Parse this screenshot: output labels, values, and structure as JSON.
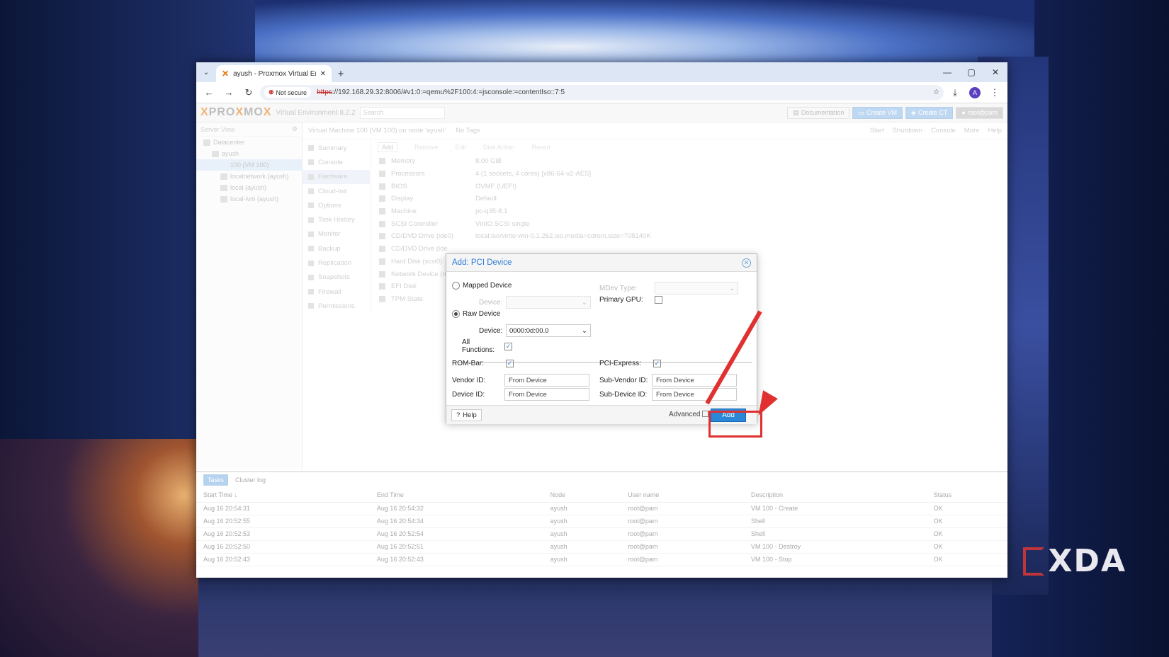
{
  "browser": {
    "tab_title": "ayush - Proxmox Virtual Enviro",
    "not_secure": "Not secure",
    "url_scheme": "https",
    "url_rest": "://192.168.29.32:8006/#v1:0:=qemu%2F100:4:=jsconsole:=contentIso::7:5",
    "avatar_letter": "A"
  },
  "pve": {
    "logo_a": "PRO",
    "logo_x": "X",
    "logo_b": "MO",
    "logo_x2": "X",
    "version": "Virtual Environment 8.2.2",
    "search_placeholder": "Search",
    "header_buttons": [
      "Documentation",
      "Create VM",
      "Create CT",
      "root@pam"
    ],
    "server_view": "Server View",
    "tree": [
      "Datacenter",
      "ayush",
      "100 (VM 100)",
      "localnetwork (ayush)",
      "local (ayush)",
      "local-lvm (ayush)"
    ],
    "crumb_title": "Virtual Machine 100 (VM 100) on node 'ayush'",
    "no_tags": "No Tags",
    "crumb_actions": [
      "Start",
      "Shutdown",
      "Console",
      "More",
      "Help"
    ],
    "vm_nav": [
      "Summary",
      "Console",
      "Hardware",
      "Cloud-Init",
      "Options",
      "Task History",
      "Monitor",
      "Backup",
      "Replication",
      "Snapshots",
      "Firewall",
      "Permissions"
    ],
    "hw_toolbar": [
      "Add",
      "Remove",
      "Edit",
      "Disk Action",
      "Revert"
    ],
    "hardware": [
      {
        "k": "Memory",
        "v": "8.00 GiB"
      },
      {
        "k": "Processors",
        "v": "4 (1 sockets, 4 cores) [x86-64-v2-AES]"
      },
      {
        "k": "BIOS",
        "v": "OVMF (UEFI)"
      },
      {
        "k": "Display",
        "v": "Default"
      },
      {
        "k": "Machine",
        "v": "pc-q35-8.1"
      },
      {
        "k": "SCSI Controller",
        "v": "VirtIO SCSI single"
      },
      {
        "k": "CD/DVD Drive (ide0)",
        "v": "local:iso/virtio-win-0.1.262.iso,media=cdrom,size=708140K"
      },
      {
        "k": "CD/DVD Drive (ide",
        "v": ""
      },
      {
        "k": "Hard Disk (scsi0)",
        "v": ""
      },
      {
        "k": "Network Device (n",
        "v": ""
      },
      {
        "k": "EFI Disk",
        "v": ""
      },
      {
        "k": "TPM State",
        "v": ""
      }
    ]
  },
  "tasks": {
    "tabs": [
      "Tasks",
      "Cluster log"
    ],
    "headers": [
      "Start Time ↓",
      "End Time",
      "Node",
      "User name",
      "Description",
      "Status"
    ],
    "rows": [
      [
        "Aug 16 20:54:31",
        "Aug 16 20:54:32",
        "ayush",
        "root@pam",
        "VM 100 - Create",
        "OK"
      ],
      [
        "Aug 16 20:52:55",
        "Aug 16 20:54:34",
        "ayush",
        "root@pam",
        "Shell",
        "OK"
      ],
      [
        "Aug 16 20:52:53",
        "Aug 16 20:52:54",
        "ayush",
        "root@pam",
        "Shell",
        "OK"
      ],
      [
        "Aug 16 20:52:50",
        "Aug 16 20:52:51",
        "ayush",
        "root@pam",
        "VM 100 - Destroy",
        "OK"
      ],
      [
        "Aug 16 20:52:43",
        "Aug 16 20:52:43",
        "ayush",
        "root@pam",
        "VM 100 - Stop",
        "OK"
      ]
    ]
  },
  "dialog": {
    "title": "Add: PCI Device",
    "mapped_device": "Mapped Device",
    "mdev_type": "MDev Type:",
    "device_label_dis": "Device:",
    "primary_gpu": "Primary GPU:",
    "raw_device": "Raw Device",
    "device_label": "Device:",
    "device_value": "0000:0d:00.0",
    "all_functions": "All Functions:",
    "rom_bar": "ROM-Bar:",
    "pci_express": "PCI-Express:",
    "vendor_id": "Vendor ID:",
    "sub_vendor_id": "Sub-Vendor ID:",
    "device_id": "Device ID:",
    "sub_device_id": "Sub-Device ID:",
    "from_device": "From Device",
    "help": "Help",
    "advanced": "Advanced",
    "add": "Add",
    "mapped_selected": false,
    "raw_selected": true,
    "primary_gpu_checked": false,
    "all_functions_checked": true,
    "rom_bar_checked": true,
    "pci_express_checked": true
  },
  "watermark": "XDA",
  "colors": {
    "accent": "#2a86d6",
    "annotation": "#e03030",
    "proxmox_orange": "#e57000"
  }
}
